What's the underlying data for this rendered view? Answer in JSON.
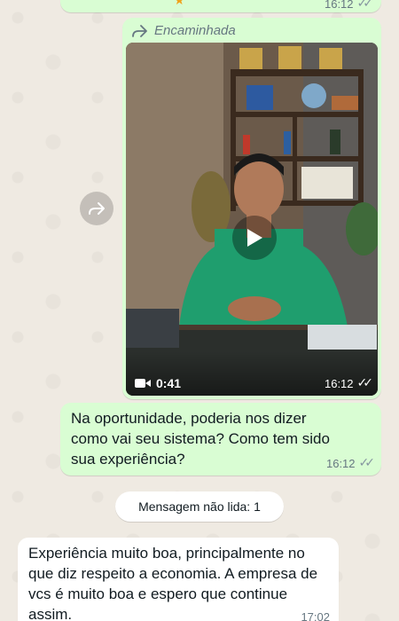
{
  "top_message": {
    "time": "16:12"
  },
  "video_message": {
    "forwarded_label": "Encaminhada",
    "duration": "0:41",
    "time": "16:12"
  },
  "outgoing_message": {
    "text": "Na oportunidade, poderia nos dizer como vai seu sistema? Como tem sido sua experiência?",
    "time": "16:12"
  },
  "unread_banner": {
    "text": "Mensagem não lida: 1"
  },
  "incoming_message": {
    "text": "Experiência muito boa, principalmente no que diz respeito a economia. A empresa de vcs é muito boa e espero que continue assim.",
    "time": "17:02"
  },
  "colors": {
    "chat_background": "#efeae2",
    "outgoing_bubble": "#d9fdd3",
    "incoming_bubble": "#ffffff",
    "meta_text": "#667781"
  },
  "icons": [
    "forward-icon",
    "play-icon",
    "video-camera-icon",
    "double-check-icon"
  ]
}
